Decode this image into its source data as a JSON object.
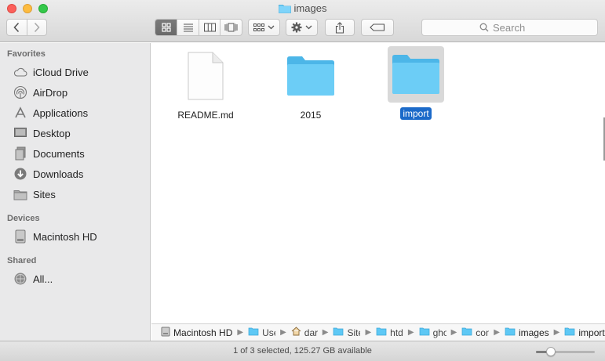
{
  "window": {
    "title": "images"
  },
  "toolbar": {
    "search_placeholder": "Search"
  },
  "sidebar": {
    "sections": [
      {
        "heading": "Favorites"
      },
      {
        "heading": "Devices"
      },
      {
        "heading": "Shared"
      }
    ],
    "favorites": [
      {
        "label": "iCloud Drive",
        "icon": "cloud-icon"
      },
      {
        "label": "AirDrop",
        "icon": "airdrop-icon"
      },
      {
        "label": "Applications",
        "icon": "applications-icon"
      },
      {
        "label": "Desktop",
        "icon": "desktop-icon"
      },
      {
        "label": "Documents",
        "icon": "documents-icon"
      },
      {
        "label": "Downloads",
        "icon": "downloads-icon"
      },
      {
        "label": "Sites",
        "icon": "folder-icon"
      }
    ],
    "devices": [
      {
        "label": "Macintosh HD",
        "icon": "hard-drive-icon"
      }
    ],
    "shared": [
      {
        "label": "All...",
        "icon": "network-icon"
      }
    ]
  },
  "files": [
    {
      "name": "README.md",
      "kind": "document",
      "selected": false
    },
    {
      "name": "2015",
      "kind": "folder",
      "selected": false
    },
    {
      "name": "import",
      "kind": "folder",
      "selected": true
    }
  ],
  "pathbar": {
    "crumbs": [
      {
        "label": "Macintosh HD",
        "icon": "hard-drive-icon"
      },
      {
        "label": "Use",
        "icon": "users-folder-icon"
      },
      {
        "label": "dar",
        "icon": "home-icon"
      },
      {
        "label": "Site",
        "icon": "sites-folder-icon"
      },
      {
        "label": "htd",
        "icon": "folder-icon"
      },
      {
        "label": "gho",
        "icon": "folder-icon"
      },
      {
        "label": "con",
        "icon": "folder-icon"
      },
      {
        "label": "images",
        "icon": "folder-icon"
      },
      {
        "label": "import",
        "icon": "folder-icon"
      }
    ]
  },
  "status": {
    "text": "1 of 3 selected, 125.27 GB available",
    "icon_size_level": 0.25
  },
  "colors": {
    "folder_blue": "#5ec8f5",
    "selection_blue": "#1b6ac9"
  }
}
